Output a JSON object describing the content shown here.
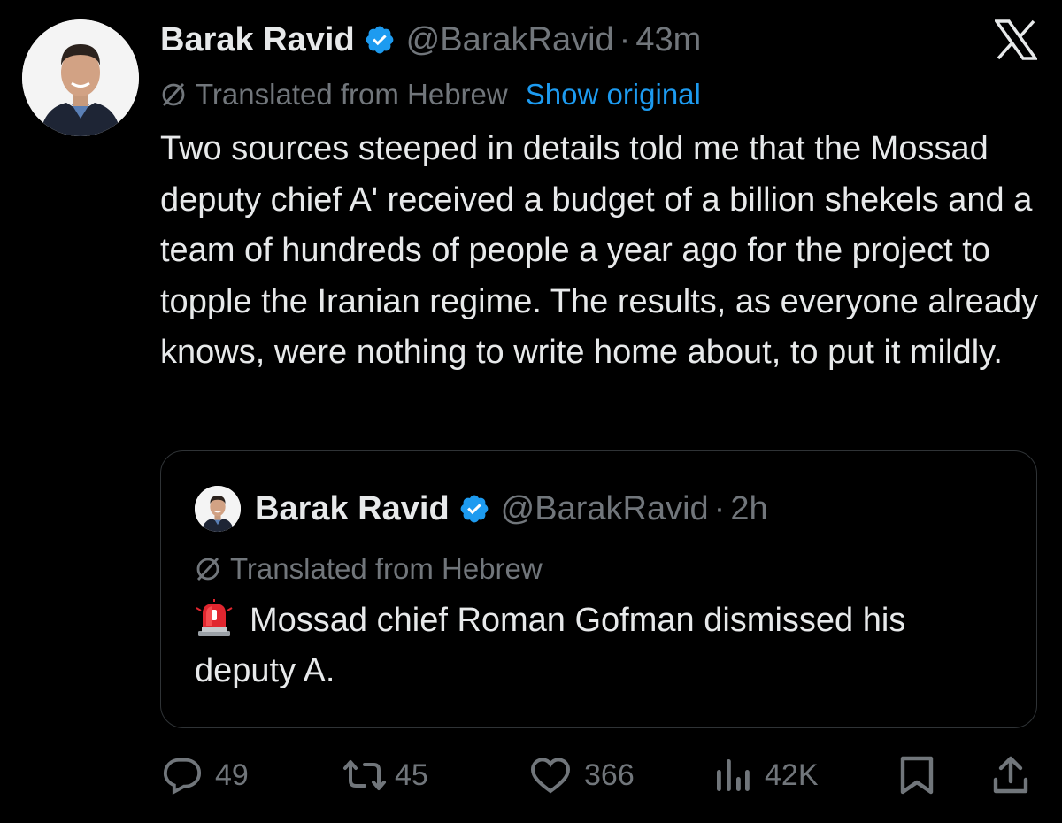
{
  "tweet": {
    "author": {
      "display_name": "Barak Ravid",
      "handle": "@BarakRavid",
      "verified": true
    },
    "separator": "·",
    "time": "43m",
    "translation": {
      "label": "Translated from Hebrew",
      "show_original": "Show original"
    },
    "text": "Two sources steeped in details told me that the Mossad deputy chief A' received a budget of a billion shekels and a team of hundreds of people a year ago for the project to topple the Iranian regime. The results, as everyone already knows, were nothing to write home about, to put it mildly."
  },
  "quoted_tweet": {
    "author": {
      "display_name": "Barak Ravid",
      "handle": "@BarakRavid",
      "verified": true
    },
    "separator": "·",
    "time": "2h",
    "translation": {
      "label": "Translated from Hebrew"
    },
    "emoji": "siren-icon",
    "text": "Mossad chief Roman Gofman dismissed his deputy A."
  },
  "actions": {
    "replies": "49",
    "reposts": "45",
    "likes": "366",
    "views": "42K"
  },
  "icons": {
    "close": "x-logo-icon",
    "translate": "globe-slash-icon",
    "verified": "verified-badge-icon",
    "reply": "reply-icon",
    "repost": "repost-icon",
    "like": "heart-icon",
    "views": "views-icon",
    "bookmark": "bookmark-icon",
    "share": "share-icon"
  },
  "colors": {
    "background": "#000000",
    "text_primary": "#e7e9ea",
    "text_secondary": "#71767b",
    "accent_blue": "#1d9bf0",
    "border": "#2f3336"
  }
}
